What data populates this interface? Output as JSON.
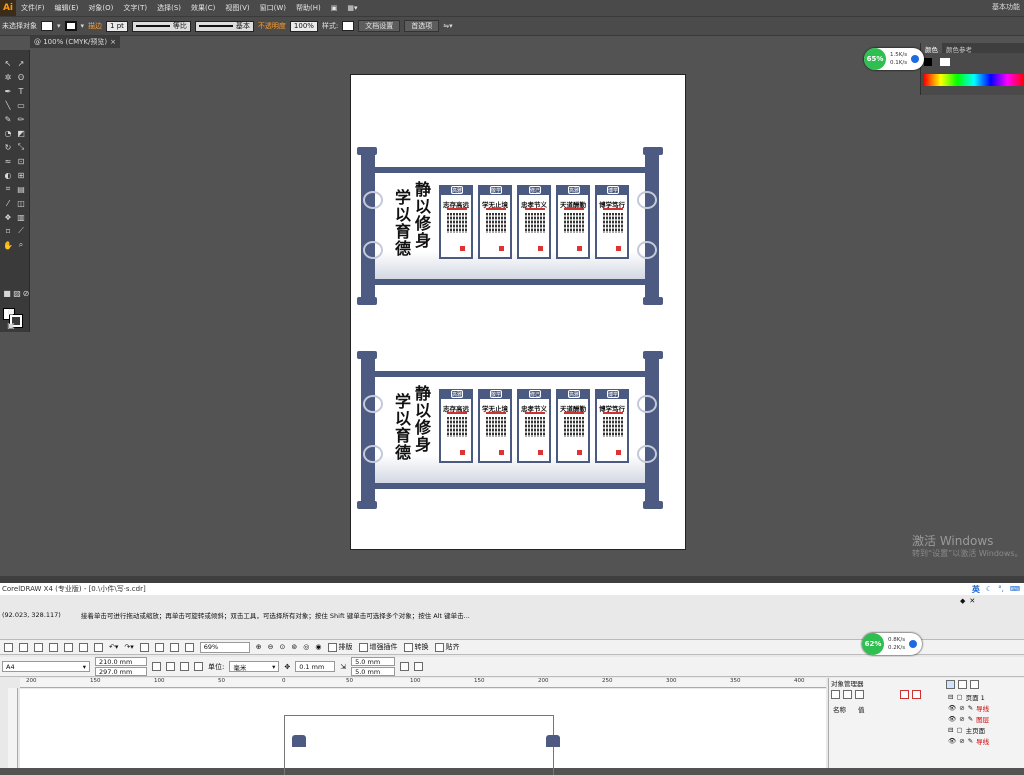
{
  "ai": {
    "menu": [
      "文件(F)",
      "编辑(E)",
      "对象(O)",
      "文字(T)",
      "选择(S)",
      "效果(C)",
      "视图(V)",
      "窗口(W)",
      "帮助(H)"
    ],
    "workspace": "基本功能",
    "control": {
      "no_selection": "未选择对象",
      "stroke_label": "描边",
      "stroke_value": "1 pt",
      "stroke_profile": "等比",
      "brush": "基本",
      "opacity_label": "不透明度",
      "opacity_value": "100%",
      "style_label": "样式:",
      "doc_setup": "文档设置",
      "prefs": "首选项"
    },
    "tab_title": "@ 100% (CMYK/预览)",
    "color_panel_tabs": [
      "颜色",
      "颜色参考"
    ],
    "activate_title": "激活 Windows",
    "activate_sub": "转到“设置”以激活 Windows。"
  },
  "artwork": {
    "title_right": "静以修身",
    "title_left": "学以育德",
    "cards": [
      {
        "tag": "高雅",
        "label": "志存高远"
      },
      {
        "tag": "敬学",
        "label": "学无止境"
      },
      {
        "tag": "修己",
        "label": "忠孝节义"
      },
      {
        "tag": "高雅",
        "label": "天道酬勤"
      },
      {
        "tag": "博学",
        "label": "博学笃行"
      }
    ]
  },
  "speed_top": {
    "percent": "65%",
    "up": "1.5K/s",
    "down": "0.1K/s"
  },
  "speed_bottom": {
    "percent": "62%",
    "up": "0.8K/s",
    "down": "0.2K/s"
  },
  "corel": {
    "title": "CorelDRAW X4 (专业版) - [0.\\小件\\写·s.cdr]",
    "ime": "英",
    "coords": "(92.023, 328.117)",
    "hint": "接着单击可进行拖动或缩放；再单击可旋转或倾斜；双击工具，可选择所有对象；按住 Shift 键单击可选择多个对象；按住 Alt 键单击...",
    "zoom": "69%",
    "menu_buttons": [
      "排版",
      "增强插件",
      "转换",
      "贴齐"
    ],
    "page_size": "A4",
    "width": "210.0 mm",
    "height": "297.0 mm",
    "unit_label": "单位:",
    "unit": "毫米",
    "nudge": "0.1 mm",
    "dup_x": "5.0 mm",
    "dup_y": "5.0 mm",
    "ruler_ticks": [
      "200",
      "150",
      "100",
      "50",
      "0",
      "50",
      "100",
      "150",
      "200",
      "250",
      "300",
      "350",
      "400"
    ],
    "object_manager": {
      "title": "对象管理器",
      "col_name": "名称",
      "col_value": "值",
      "layers": [
        {
          "name": "页面 1",
          "sub": "导线"
        },
        {
          "name": "",
          "sub": "图层"
        },
        {
          "name": "主页面",
          "sub": "导线"
        }
      ]
    }
  }
}
